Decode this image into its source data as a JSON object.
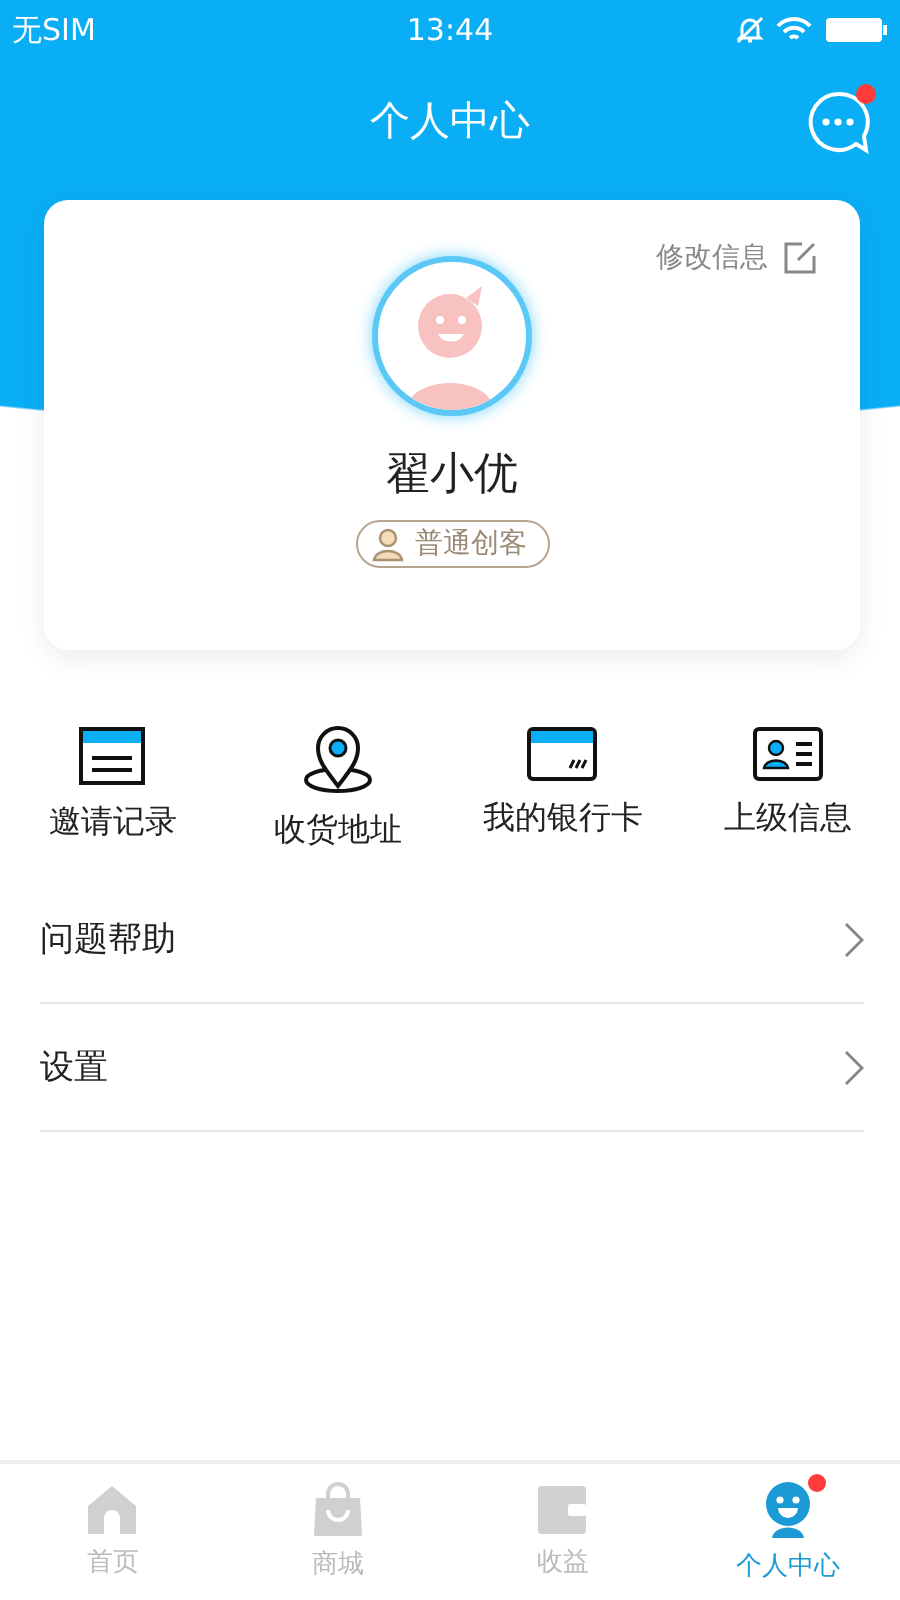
{
  "status_bar": {
    "carrier": "无SIM",
    "time": "13:44"
  },
  "nav": {
    "title": "个人中心",
    "messages_unread": true
  },
  "profile": {
    "edit_label": "修改信息",
    "name": "翟小优",
    "level_badge": "普通创客"
  },
  "shortcuts": [
    {
      "kind": "invite",
      "label": "邀请记录"
    },
    {
      "kind": "address",
      "label": "收货地址"
    },
    {
      "kind": "card",
      "label": "我的银行卡"
    },
    {
      "kind": "superior",
      "label": "上级信息"
    }
  ],
  "menu": [
    {
      "label": "问题帮助"
    },
    {
      "label": "设置"
    }
  ],
  "tabs": [
    {
      "kind": "home",
      "label": "首页",
      "selected": false,
      "unread": false
    },
    {
      "kind": "shop",
      "label": "商城",
      "selected": false,
      "unread": false
    },
    {
      "kind": "income",
      "label": "收益",
      "selected": false,
      "unread": false
    },
    {
      "kind": "profile",
      "label": "个人中心",
      "selected": true,
      "unread": true
    }
  ]
}
